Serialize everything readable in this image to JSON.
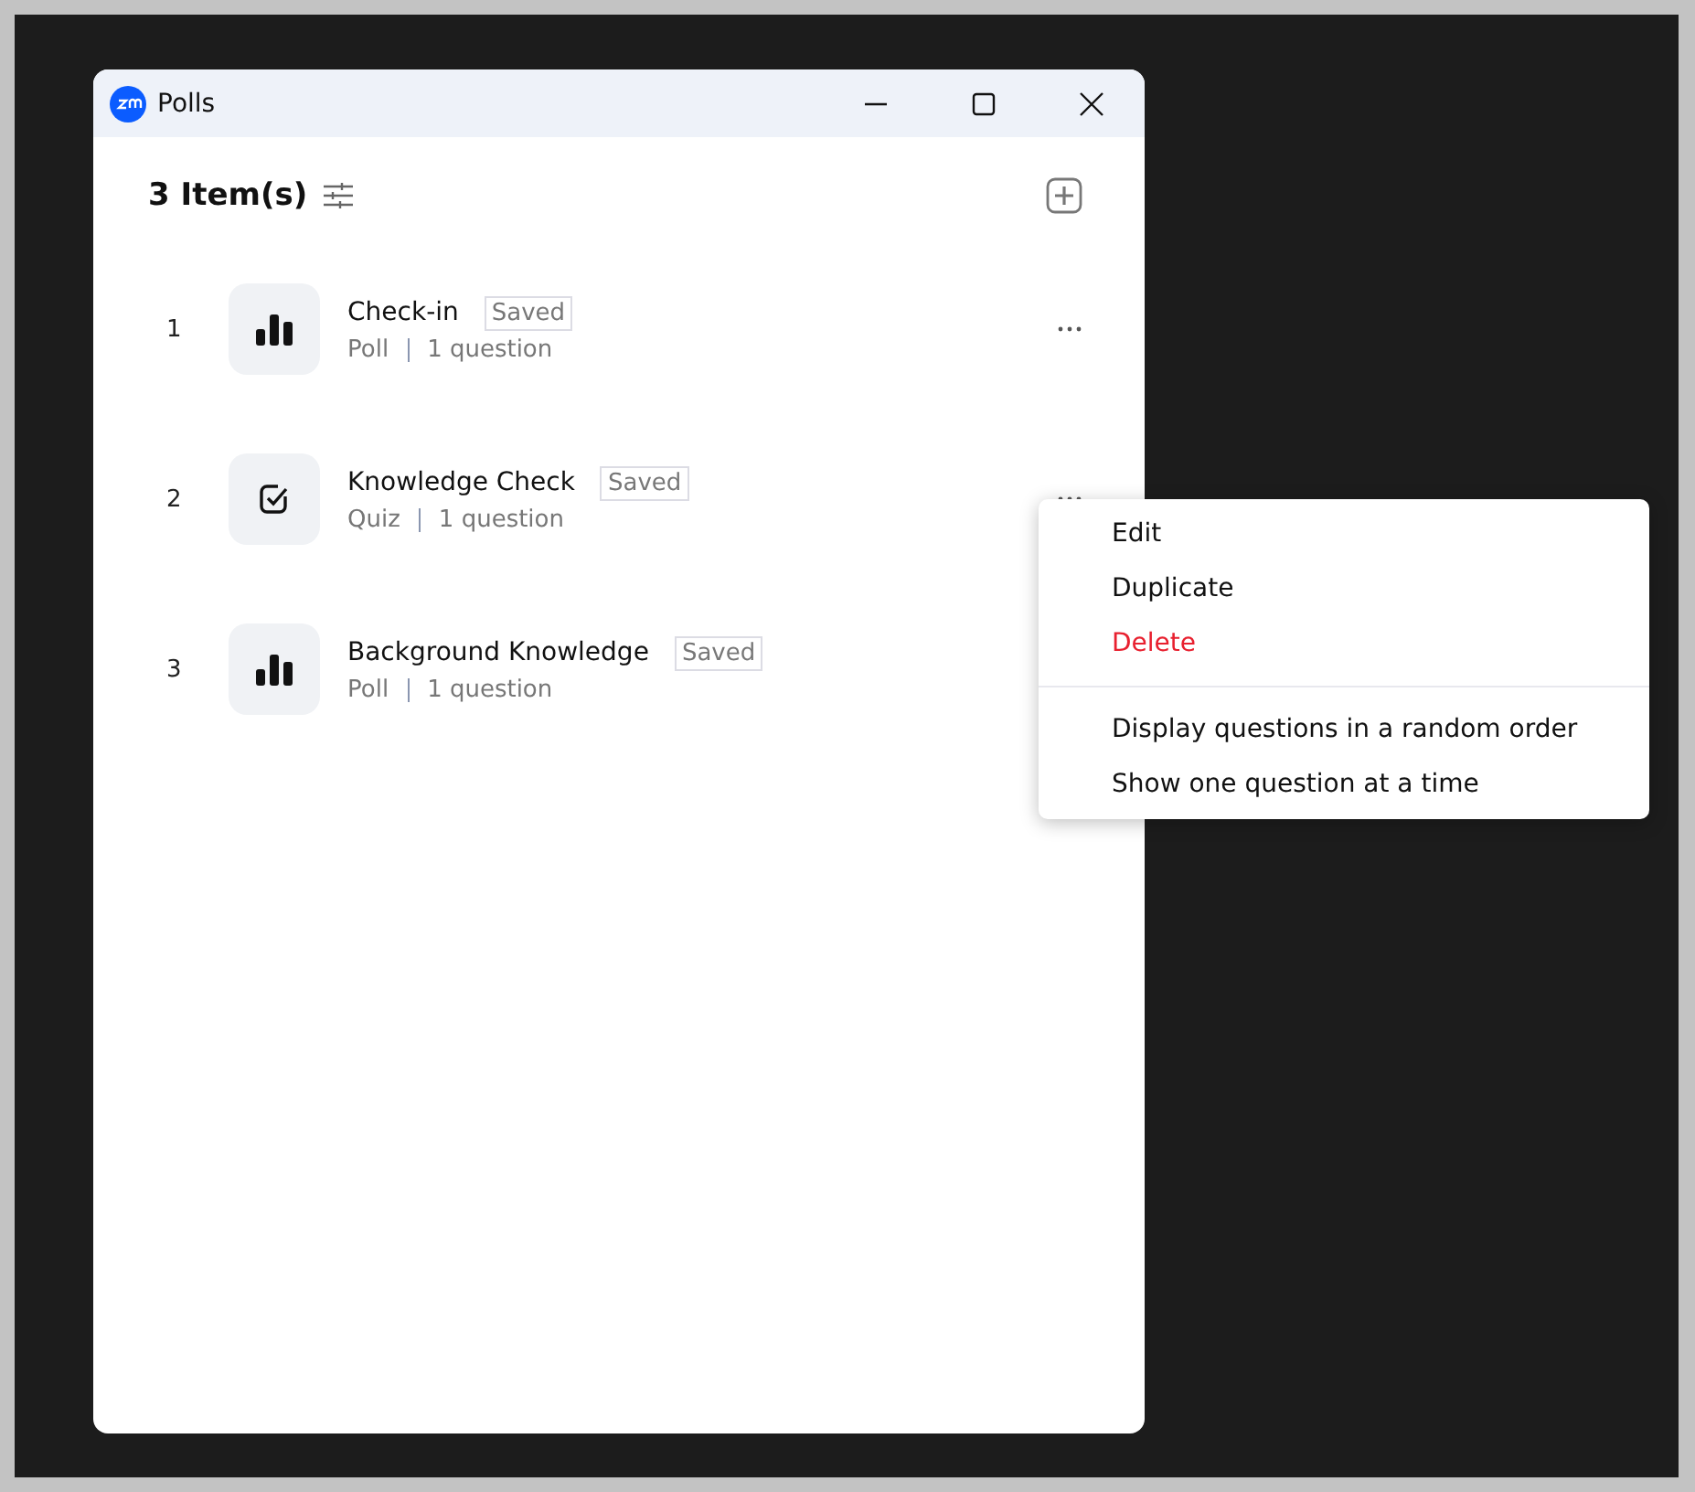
{
  "window": {
    "title": "Polls"
  },
  "header": {
    "count": "3 Item(s)"
  },
  "items": [
    {
      "number": "1",
      "title": "Check-in",
      "status": "Saved",
      "kind": "poll",
      "type": "Poll",
      "questions": "1 question"
    },
    {
      "number": "2",
      "title": "Knowledge Check",
      "status": "Saved",
      "kind": "quiz",
      "type": "Quiz",
      "questions": "1 question"
    },
    {
      "number": "3",
      "title": "Background Knowledge",
      "status": "Saved",
      "kind": "poll",
      "type": "Poll",
      "questions": "1 question"
    }
  ],
  "context_menu": {
    "groups": [
      [
        {
          "label": "Edit",
          "kind": "normal"
        },
        {
          "label": "Duplicate",
          "kind": "normal"
        },
        {
          "label": "Delete",
          "kind": "danger"
        }
      ],
      [
        {
          "label": "Display questions in a random order",
          "kind": "normal"
        },
        {
          "label": "Show one question at a time",
          "kind": "normal"
        }
      ]
    ]
  }
}
